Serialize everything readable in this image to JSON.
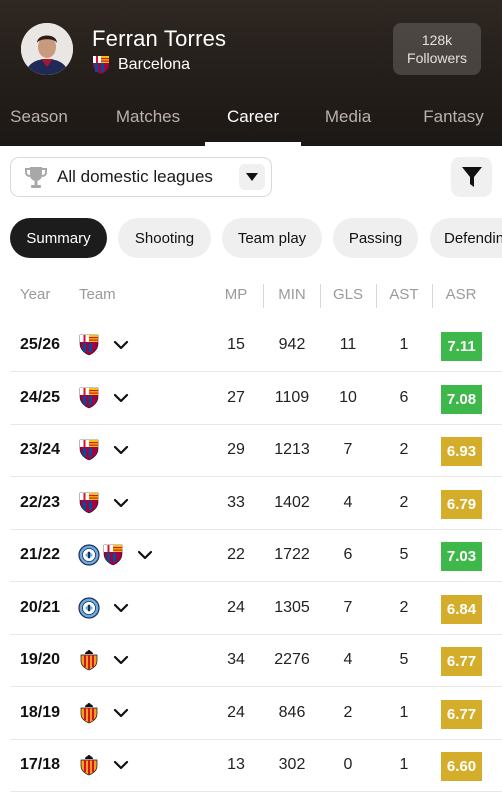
{
  "profile": {
    "name": "Ferran Torres",
    "club": "Barcelona",
    "followers_count": "128k",
    "followers_label": "Followers"
  },
  "tabs": [
    {
      "label": "Season",
      "active": false
    },
    {
      "label": "Matches",
      "active": false
    },
    {
      "label": "Career",
      "active": true
    },
    {
      "label": "Media",
      "active": false
    },
    {
      "label": "Fantasy",
      "active": false
    }
  ],
  "filter": {
    "league_selected": "All domestic leagues",
    "league_icon": "trophy-icon",
    "filter_icon": "funnel-icon"
  },
  "chips": [
    {
      "label": "Summary",
      "active": true
    },
    {
      "label": "Shooting",
      "active": false
    },
    {
      "label": "Team play",
      "active": false
    },
    {
      "label": "Passing",
      "active": false
    },
    {
      "label": "Defending",
      "active": false
    }
  ],
  "table": {
    "headers": {
      "year": "Year",
      "team": "Team",
      "mp": "MP",
      "min": "MIN",
      "gls": "GLS",
      "ast": "AST",
      "asr": "ASR"
    },
    "rows": [
      {
        "year": "25/26",
        "teams": [
          "barcelona"
        ],
        "mp": "15",
        "min": "942",
        "gls": "11",
        "ast": "1",
        "asr": "7.11",
        "asr_color": "#3fb84b"
      },
      {
        "year": "24/25",
        "teams": [
          "barcelona"
        ],
        "mp": "27",
        "min": "1109",
        "gls": "10",
        "ast": "6",
        "asr": "7.08",
        "asr_color": "#3fb84b"
      },
      {
        "year": "23/24",
        "teams": [
          "barcelona"
        ],
        "mp": "29",
        "min": "1213",
        "gls": "7",
        "ast": "2",
        "asr": "6.93",
        "asr_color": "#d4ae2a"
      },
      {
        "year": "22/23",
        "teams": [
          "barcelona"
        ],
        "mp": "33",
        "min": "1402",
        "gls": "4",
        "ast": "2",
        "asr": "6.79",
        "asr_color": "#d4ae2a"
      },
      {
        "year": "21/22",
        "teams": [
          "man-city",
          "barcelona"
        ],
        "mp": "22",
        "min": "1722",
        "gls": "6",
        "ast": "5",
        "asr": "7.03",
        "asr_color": "#3fb84b"
      },
      {
        "year": "20/21",
        "teams": [
          "man-city"
        ],
        "mp": "24",
        "min": "1305",
        "gls": "7",
        "ast": "2",
        "asr": "6.84",
        "asr_color": "#d4ae2a"
      },
      {
        "year": "19/20",
        "teams": [
          "valencia"
        ],
        "mp": "34",
        "min": "2276",
        "gls": "4",
        "ast": "5",
        "asr": "6.77",
        "asr_color": "#d4ae2a"
      },
      {
        "year": "18/19",
        "teams": [
          "valencia"
        ],
        "mp": "24",
        "min": "846",
        "gls": "2",
        "ast": "1",
        "asr": "6.77",
        "asr_color": "#d4ae2a"
      },
      {
        "year": "17/18",
        "teams": [
          "valencia"
        ],
        "mp": "13",
        "min": "302",
        "gls": "0",
        "ast": "1",
        "asr": "6.60",
        "asr_color": "#d4ae2a"
      }
    ]
  }
}
